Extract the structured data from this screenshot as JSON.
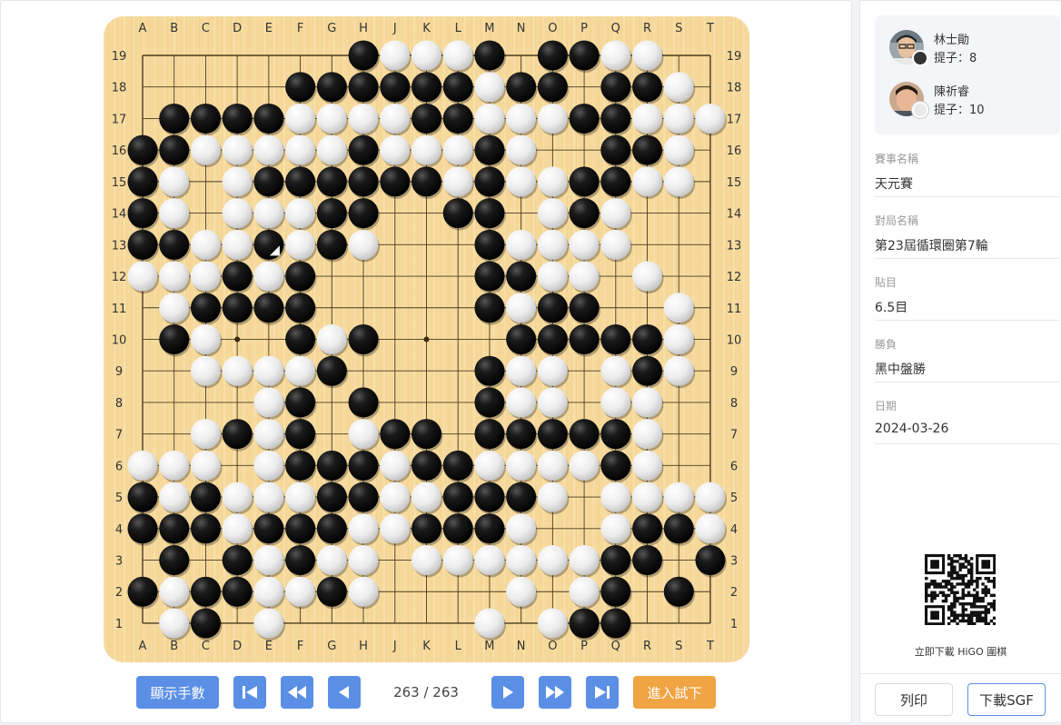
{
  "board": {
    "columns": [
      "A",
      "B",
      "C",
      "D",
      "E",
      "F",
      "G",
      "H",
      "J",
      "K",
      "L",
      "M",
      "N",
      "O",
      "P",
      "Q",
      "R",
      "S",
      "T"
    ],
    "rows": [
      "19",
      "18",
      "17",
      "16",
      "15",
      "14",
      "13",
      "12",
      "11",
      "10",
      "9",
      "8",
      "7",
      "6",
      "5",
      "4",
      "3",
      "2",
      "1"
    ],
    "last_move": "E13",
    "stones": [
      "19 .......BWWWB.BBWW..",
      "18 .....BBBBBBWBB.BBW.",
      "17 .BBBBWWWWBBWWWBBWWW",
      "16 BBWWWWWBWWWBW..BBW.",
      "15 BW.WBBBBBBWBWWBBWW.",
      "14 BW.WWWBB..BB.WBW...",
      "13 BBWWBWBW...BWWWW...",
      "12 WWWBWB.....BBWW.W..",
      "11 .WBBBB.....BWBB..W.",
      "10 .BW..BWB....BBBBBW.",
      "9  ..WWWWB....BWW.WBW.",
      "8  ....WB.B...BWW.WW..",
      "7  ..WBWB.WBB.BBBBBW..",
      "6  WWW.WBBBWBBWWWWBW..",
      "5  BWBWWWBBWWBBBW.WWWW",
      "4  BBBWBBBWWBBBW..WBBW",
      "3  .B.BWBWW.WWWWWWBB.B",
      "2  BWBBWWBW....W.WB.B.",
      "1  .WB.W......W.WBB..."
    ]
  },
  "controls": {
    "show_moves": "顯示手數",
    "move_counter": "263 / 263",
    "try_mode": "進入試下"
  },
  "players": [
    {
      "name": "林士勛",
      "captures": "提子：8",
      "color": "black"
    },
    {
      "name": "陳祈睿",
      "captures": "提子：10",
      "color": "white"
    }
  ],
  "info": [
    {
      "label": "賽事名稱",
      "value": "天元賽"
    },
    {
      "label": "對局名稱",
      "value": "第23屆循環圈第7輪"
    },
    {
      "label": "貼目",
      "value": "6.5目"
    },
    {
      "label": "勝負",
      "value": "黑中盤勝"
    },
    {
      "label": "日期",
      "value": "2024-03-26"
    }
  ],
  "qr_caption": "立即下載 HiGO 圍棋",
  "buttons": {
    "print": "列印",
    "download": "下載SGF"
  },
  "colors": {
    "accent_blue": "#5b8fe6",
    "accent_orange": "#f0a443",
    "board": "#f6d99a"
  }
}
